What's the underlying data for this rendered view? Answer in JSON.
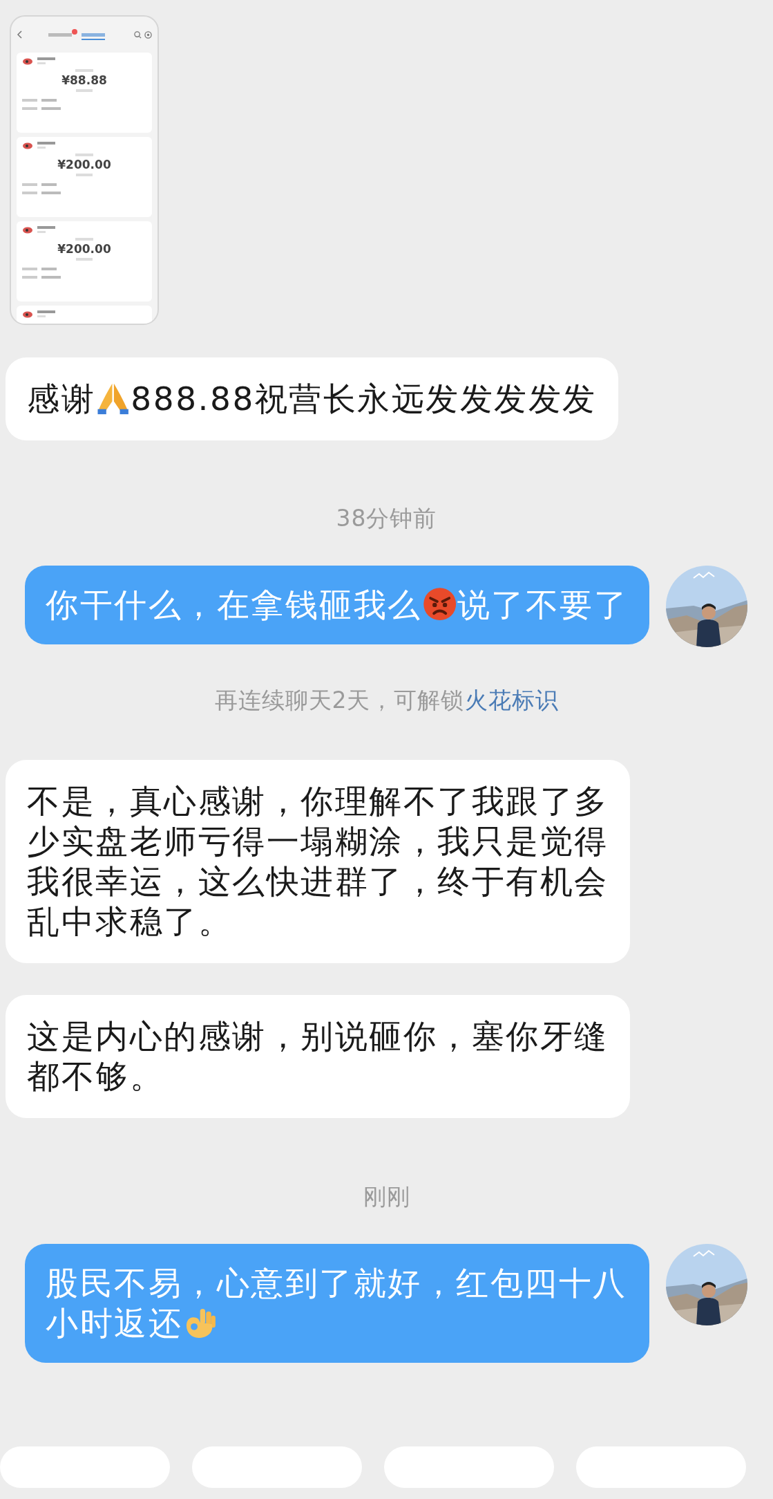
{
  "chat": [
    {
      "cards": [
        {
          "amount": "¥88.88"
        },
        {
          "amount": "¥200.00"
        },
        {
          "amount": "¥200.00"
        }
      ]
    },
    {
      "kind": "incoming",
      "parts": [
        {
          "kind": "text",
          "text": "感谢"
        },
        {
          "kind": "pray"
        },
        {
          "kind": "text",
          "text": "888.88祝营长永远发发发发发"
        }
      ]
    },
    {
      "kind": "time",
      "text": "38分钟前"
    },
    {
      "kind": "outgoing",
      "parts": [
        {
          "kind": "text",
          "text": "你干什么，在拿钱砸我么"
        },
        {
          "kind": "angry"
        },
        {
          "kind": "text",
          "text": "说了不要"
        },
        {
          "kind": "text",
          "text": "了"
        }
      ]
    },
    {
      "kind": "notice",
      "text": "再连续聊天2天，可解锁",
      "link": "火花标识"
    },
    {
      "kind": "incoming",
      "parts": [
        {
          "kind": "text",
          "text": "不是，真心感谢，你理解不了我跟了多少实盘老师亏得一塌糊涂，我只是觉得我很幸运，这么快进群了，终于有机会乱中求稳了。"
        }
      ]
    },
    {
      "kind": "incoming",
      "parts": [
        {
          "kind": "text",
          "text": "这是内心的感谢，别说砸你，塞你牙缝都不够。"
        }
      ]
    },
    {
      "kind": "time",
      "text": "刚刚"
    },
    {
      "kind": "outgoing",
      "parts": [
        {
          "kind": "text",
          "text": "股民不易，心意到了就好，红包四十八"
        },
        {
          "kind": "text",
          "text": "小时返还"
        },
        {
          "kind": "ok"
        }
      ]
    }
  ]
}
